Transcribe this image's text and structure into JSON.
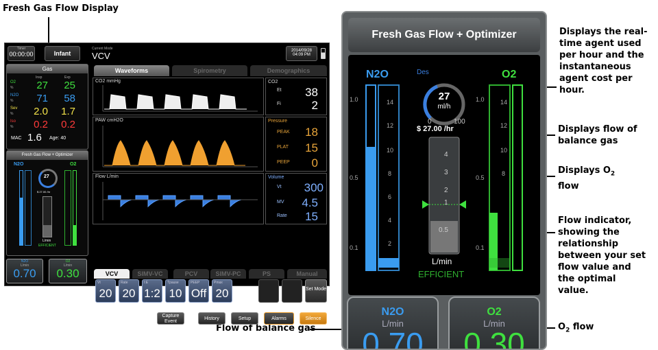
{
  "callouts": {
    "top_left": "Fresh Gas Flow Display",
    "agent_lines": [
      "Displays the real-",
      "time agent used",
      "per hour and the",
      "instantaneous",
      "agent cost per",
      "hour."
    ],
    "balance_lines": [
      "Displays flow of",
      "balance gas"
    ],
    "o2_flow_display_prefix": "Displays O",
    "o2_sub": "2",
    "o2_flow_display_suffix": "flow",
    "flow_indicator_lines": [
      "Flow indicator,",
      "showing the",
      "relationship",
      "between your set",
      "flow value and",
      "the optimal",
      "value."
    ],
    "o2_flow_prefix": "O",
    "o2_flow_sub": "2",
    "o2_flow_suffix": " flow",
    "balance_gas_flow": "Flow of balance gas"
  },
  "screen": {
    "timer_label": "Timer",
    "timer_value": "00:00:00",
    "patient_type": "Infant",
    "current_mode_label": "Current Mode",
    "current_mode": "VCV",
    "date": "2014/09/28",
    "time": "04:09 PM",
    "gas_header": "Gas",
    "gas_col_insp": "Insp",
    "gas_col_exp": "Exp",
    "gas_rows": [
      {
        "name": "O2",
        "unit": "%",
        "insp": "27",
        "exp": "25",
        "color": "#3fe03f"
      },
      {
        "name": "N2O",
        "unit": "%",
        "insp": "71",
        "exp": "58",
        "color": "#3a9cf0"
      },
      {
        "name": "Sev",
        "unit": "%",
        "insp": "2.0",
        "exp": "1.7",
        "color": "#f2e24a"
      },
      {
        "name": "Iso",
        "unit": "%",
        "insp": "0.2",
        "exp": "0.2",
        "color": "#ff3b3b"
      }
    ],
    "mac_label": "MAC",
    "mac_value": "1.6",
    "age": "Age: 40",
    "fgf_title": "Fresh Gas Flow + Optimizer",
    "fgf_n2o": "N2O",
    "fgf_o2": "O2",
    "fgf_agent_value": "27",
    "fgf_agent_cost": "$ 27.00 /hr",
    "fgf_lmin": "L/min",
    "fgf_efficient": "EFFICIENT",
    "flow_n2o_label": "N2O",
    "flow_o2_label": "O2",
    "flow_unit": "L/min",
    "flow_n2o_value": "0.70",
    "flow_o2_value": "0.30",
    "tabs": [
      "Waveforms",
      "Spirometry",
      "Demographics"
    ],
    "wave_titles": [
      "CO2 mmHg",
      "PAW cmH2O",
      "Flow L/min"
    ],
    "co2_label": "CO2",
    "et_label": "Et",
    "fi_label": "Fi",
    "et_value": "38",
    "fi_value": "2",
    "pressure_label": "Pressure",
    "peak_label": "PEAK",
    "plat_label": "PLAT",
    "peep_label": "PEEP",
    "peak_value": "18",
    "plat_value": "15",
    "peep_value": "0",
    "volume_label": "Volume",
    "vt_label": "Vt",
    "mv_label": "MV",
    "rate_label": "Rate",
    "vt_value": "300",
    "mv_value": "4.5",
    "rate_value": "15",
    "modes": [
      "VCV",
      "SIMV-VC",
      "PCV",
      "SIMV-PC",
      "PS",
      "Manual"
    ],
    "settings": [
      {
        "label": "Vt",
        "value": "20"
      },
      {
        "label": "Rate",
        "value": "20"
      },
      {
        "label": "I:E",
        "value": "1:2"
      },
      {
        "label": "Tpause",
        "value": "10"
      },
      {
        "label": "PEEP",
        "value": "Off"
      },
      {
        "label": "Pmax",
        "value": "20"
      }
    ],
    "set_mode": "Set Mode",
    "buttons": {
      "capture": "Capture Event",
      "history": "History",
      "setup": "Setup",
      "alarms": "Alarms",
      "silence": "Silence"
    }
  },
  "big": {
    "title": "Fresh Gas Flow + Optimizer",
    "n2o": "N2O",
    "o2": "O2",
    "agent": "Des",
    "agent_value": "27",
    "agent_unit": "ml/h",
    "dial_min": "0",
    "dial_max": "100",
    "cost": "$ 27.00 /hr",
    "scale_left": [
      "1.0",
      "0.5",
      "0.1"
    ],
    "scale_ticks": [
      "14",
      "12",
      "10",
      "8",
      "6",
      "4",
      "2"
    ],
    "opt_ticks": [
      "4",
      "3",
      "2",
      "1",
      "0.5"
    ],
    "lmin": "L/min",
    "efficient": "EFFICIENT",
    "flow_unit": "L/min",
    "n2o_flow": "0.70",
    "o2_flow": "0.30"
  }
}
